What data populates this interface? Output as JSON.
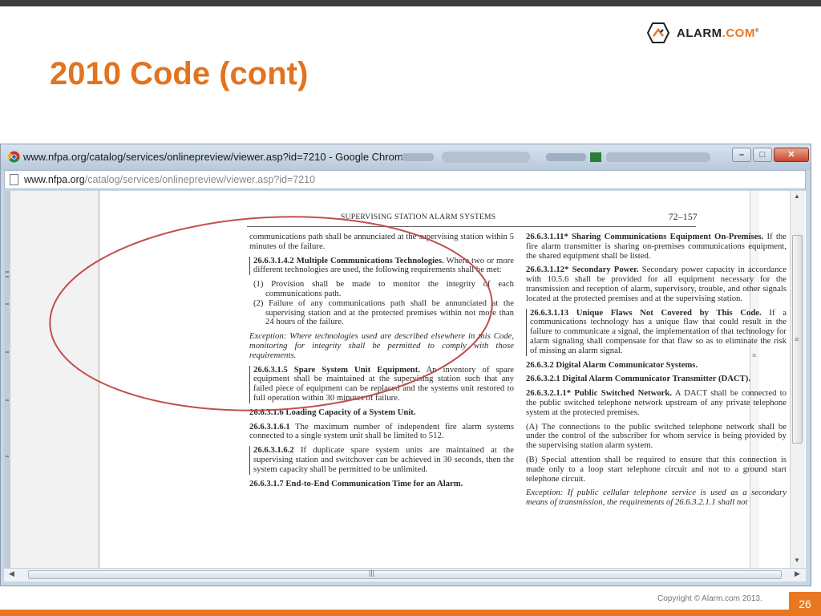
{
  "slide": {
    "title": "2010 Code (cont)",
    "brand": "ALARM",
    "brand_dot": ".COM",
    "brand_mark": "®",
    "copyright": "Copyright © Alarm.com 2013.",
    "page_number": "26",
    "accent_color": "#e87722"
  },
  "browser": {
    "window_title": "www.nfpa.org/catalog/services/onlinepreview/viewer.asp?id=7210 - Google Chrome",
    "url_domain": "www.nfpa.org",
    "url_path": "/catalog/services/onlinepreview/viewer.asp?id=7210",
    "minimize_symbol": "–",
    "maximize_symbol": "□",
    "close_symbol": "✕",
    "icons": [
      "chrome-icon",
      "page-icon"
    ]
  },
  "document": {
    "running_head": "SUPERVISING STATION ALARM SYSTEMS",
    "page_ref": "72–157",
    "left": {
      "p1": "communications path shall be annunciated at the supervising station within 5 minutes of the failure.",
      "p2_head": "26.6.3.1.4.2 Multiple Communications Technologies.",
      "p2_body": " Where two or more different technologies are used, the following requirements shall be met:",
      "item1": "(1) Provision shall be made to monitor the integrity of each communications path.",
      "item2": "(2) Failure of any communications path shall be annunciated at the supervising station and at the protected premises within not more than 24 hours of the failure.",
      "exception": "Exception: Where technologies used are described elsewhere in this Code, monitoring for integrity shall be permitted to comply with those requirements.",
      "p3_head": "26.6.3.1.5 Spare System Unit Equipment.",
      "p3_body": " An inventory of spare equipment shall be maintained at the supervising station such that any failed piece of equipment can be replaced and the systems unit restored to full operation within 30 minutes of failure.",
      "p4_head": "26.6.3.1.6 Loading Capacity of a System Unit.",
      "p5_head": "26.6.3.1.6.1",
      "p5_body": " The maximum number of independent fire alarm systems connected to a single system unit shall be limited to 512.",
      "p6_head": "26.6.3.1.6.2",
      "p6_body": " If duplicate spare system units are maintained at the supervising station and switchover can be achieved in 30 seconds, then the system capacity shall be permitted to be unlimited.",
      "p7_head": "26.6.3.1.7 End-to-End Communication Time for an Alarm."
    },
    "right": {
      "p1_head": "26.6.3.1.11* Sharing Communications Equipment On-Premises.",
      "p1_body": " If the fire alarm transmitter is sharing on-premises communications equipment, the shared equipment shall be listed.",
      "p2_head": "26.6.3.1.12* Secondary Power.",
      "p2_body": " Secondary power capacity in accordance with 10.5.6 shall be provided for all equipment necessary for the transmission and reception of alarm, supervisory, trouble, and other signals located at the protected premises and at the supervising station.",
      "p3_head": "26.6.3.1.13 Unique Flaws Not Covered by This Code.",
      "p3_body": " If a communications technology has a unique flaw that could result in the failure to communicate a signal, the implementation of that technology for alarm signaling shall compensate for that flaw so as to eliminate the risk of missing an alarm signal.",
      "p4_head": "26.6.3.2 Digital Alarm Communicator Systems.",
      "p5_head": "26.6.3.2.1 Digital Alarm Communicator Transmitter (DACT).",
      "p6_head": "26.6.3.2.1.1* Public Switched Network.",
      "p6_body": " A DACT shall be connected to the public switched telephone network upstream of any private telephone system at the protected premises.",
      "p7": "(A) The connections to the public switched telephone network shall be under the control of the subscriber for whom service is being provided by the supervising station alarm system.",
      "p8": "(B) Special attention shall be required to ensure that this connection is made only to a loop start telephone circuit and not to a ground start telephone circuit.",
      "exception": "Exception: If public cellular telephone service is used as a secondary means of transmission, the requirements of 26.6.3.2.1.1 shall not"
    }
  }
}
